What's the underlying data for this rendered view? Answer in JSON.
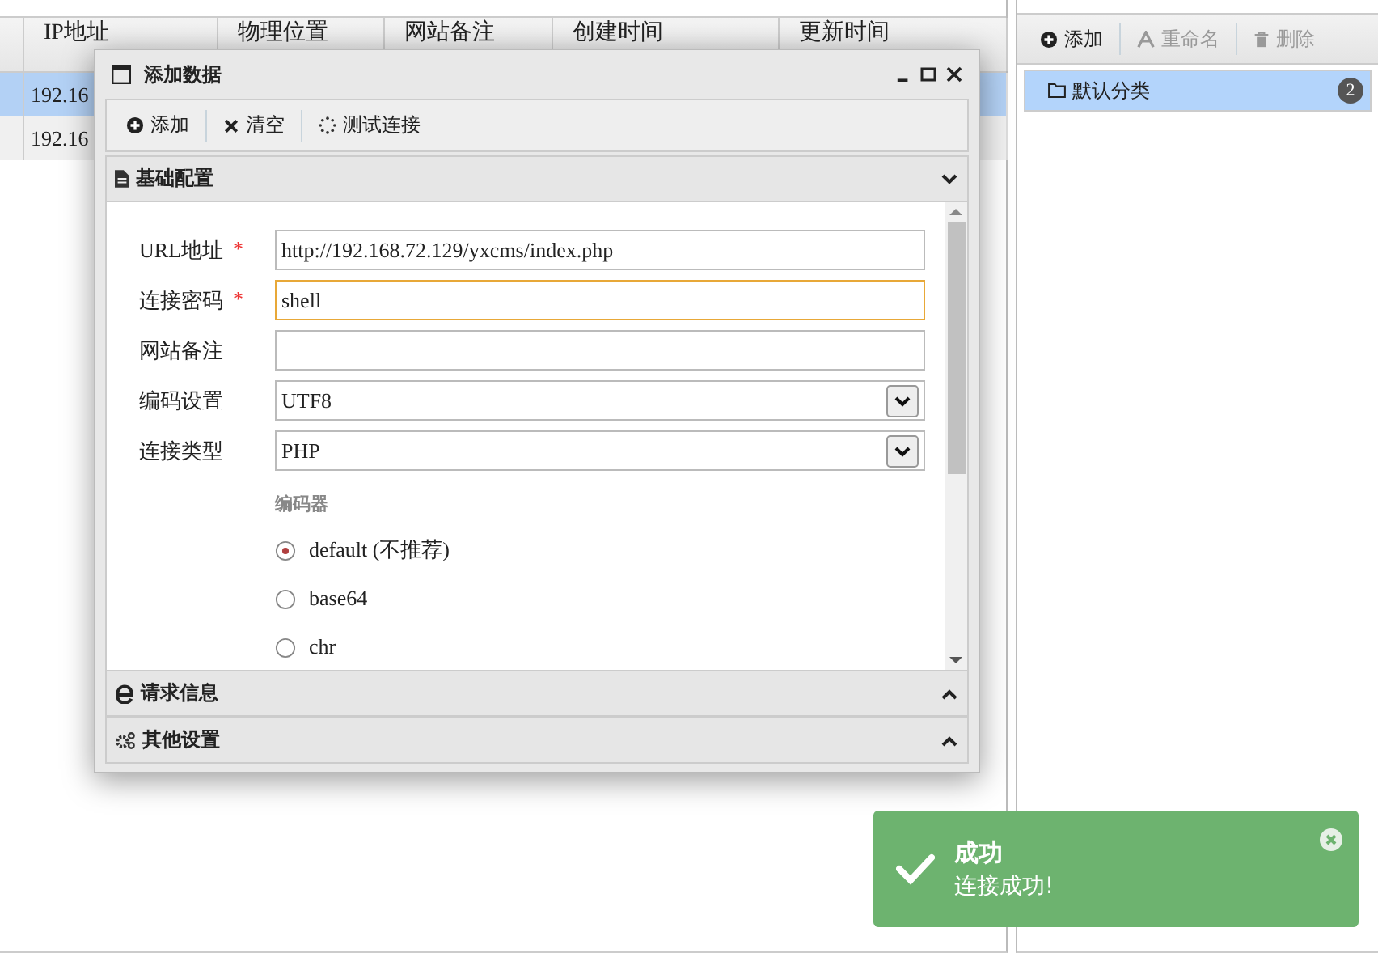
{
  "table": {
    "columns": [
      "IP地址",
      "物理位置",
      "网站备注",
      "创建时间",
      "更新时间"
    ],
    "rows": [
      {
        "cells": [
          "192.16"
        ],
        "selected": true
      },
      {
        "cells": [
          "192.16"
        ],
        "selected": false
      }
    ]
  },
  "category_toolbar": [
    {
      "label": "添加",
      "kind": "plus",
      "disabled": false
    },
    {
      "label": "重命名",
      "kind": "font",
      "disabled": true
    },
    {
      "label": "删除",
      "kind": "trash",
      "disabled": true
    }
  ],
  "categories": [
    {
      "label": "默认分类",
      "count": "2",
      "selected": true
    }
  ],
  "dialog": {
    "title": "添加数据",
    "toolbar": [
      {
        "label": "添加",
        "kind": "plus"
      },
      {
        "label": "清空",
        "kind": "cross"
      },
      {
        "label": "测试连接",
        "kind": "spinner"
      }
    ],
    "sections": [
      {
        "title": "基础配置",
        "kind": "file",
        "expanded": true
      },
      {
        "title": "请求信息",
        "kind": "e",
        "expanded": false
      },
      {
        "title": "其他设置",
        "kind": "gears",
        "expanded": false
      }
    ],
    "fields": [
      {
        "label": "URL地址",
        "required_mark": "*",
        "kind": "text",
        "value": "http://192.168.72.129/yxcms/index.php",
        "focused": false
      },
      {
        "label": "连接密码",
        "required_mark": "*",
        "kind": "text",
        "value": "shell",
        "focused": true
      },
      {
        "label": "网站备注",
        "kind": "text",
        "focused": false
      },
      {
        "label": "编码设置",
        "kind": "select",
        "value": "UTF8",
        "focused": false
      },
      {
        "label": "连接类型",
        "kind": "select",
        "value": "PHP",
        "focused": false
      }
    ],
    "encoder": {
      "title": "编码器",
      "options": [
        {
          "label": "default (不推荐)",
          "selected": true
        },
        {
          "label": "base64",
          "selected": false
        },
        {
          "label": "chr",
          "selected": false
        }
      ]
    }
  },
  "toast": {
    "title": "成功",
    "message": "连接成功!"
  }
}
